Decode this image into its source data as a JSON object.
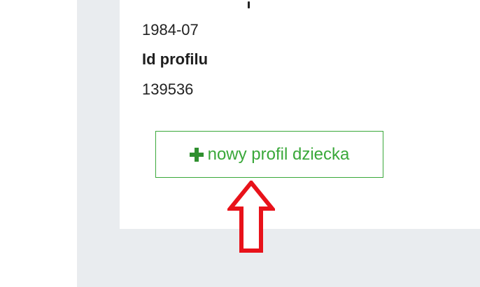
{
  "profile": {
    "birth_date": "1984-07",
    "id_label": "Id profilu",
    "id_value": "139536"
  },
  "actions": {
    "new_child_profile_label": "nowy profil dziecka",
    "new_child_profile_icon": "plus-icon"
  },
  "annotation": {
    "arrow_icon": "up-arrow-icon",
    "arrow_color": "#e8121a"
  },
  "colors": {
    "accent": "#3aa83a",
    "page_background": "#e9ecef"
  }
}
